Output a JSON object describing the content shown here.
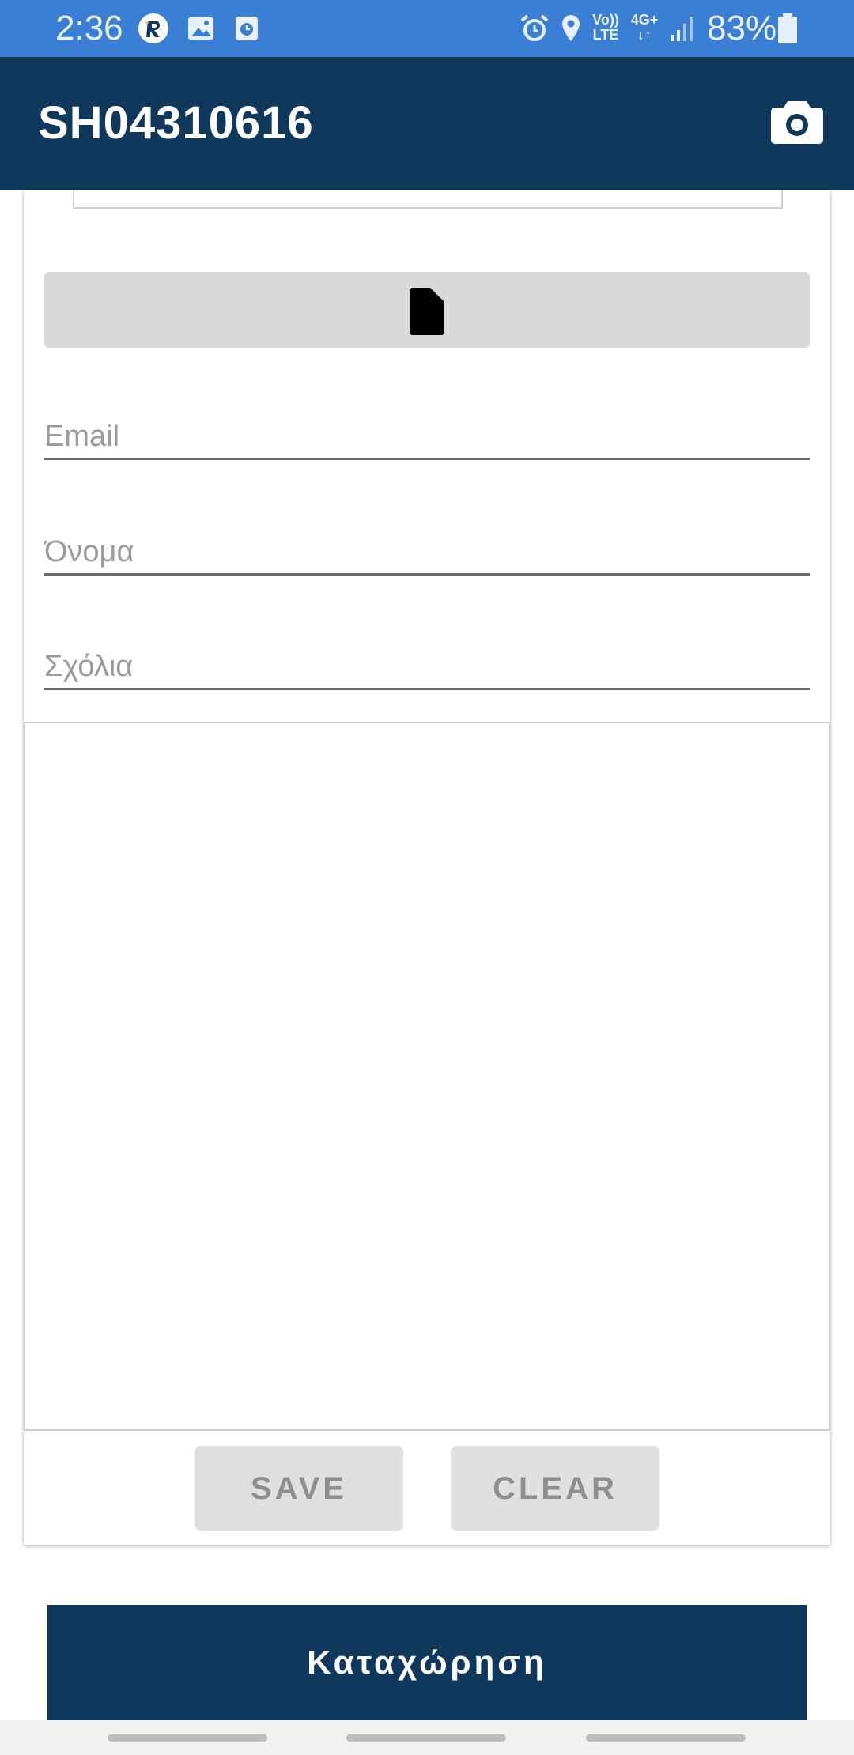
{
  "status_bar": {
    "time": "2:36",
    "volte_line1": "Vo))",
    "volte_line2": "LTE",
    "network_line1": "4G+",
    "network_line2": "↓↑",
    "battery": "83%",
    "icons": [
      "app-r-icon",
      "gallery-icon",
      "clock-app-icon",
      "alarm-icon",
      "location-icon",
      "signal-icon",
      "battery-icon"
    ]
  },
  "app_bar": {
    "title": "SH04310616",
    "action_icon": "camera-icon"
  },
  "form": {
    "file_button_icon": "file-icon",
    "email_placeholder": "Email",
    "name_placeholder": "Όνομα",
    "comments_placeholder": "Σχόλια"
  },
  "signature": {
    "save_label": "SAVE",
    "clear_label": "CLEAR"
  },
  "submit": {
    "label": "Καταχώρηση"
  },
  "colors": {
    "status_bar": "#3b7fd4",
    "primary": "#0f385c",
    "file_button": "#d7d8d8",
    "pad_button": "#e0e0e0"
  }
}
